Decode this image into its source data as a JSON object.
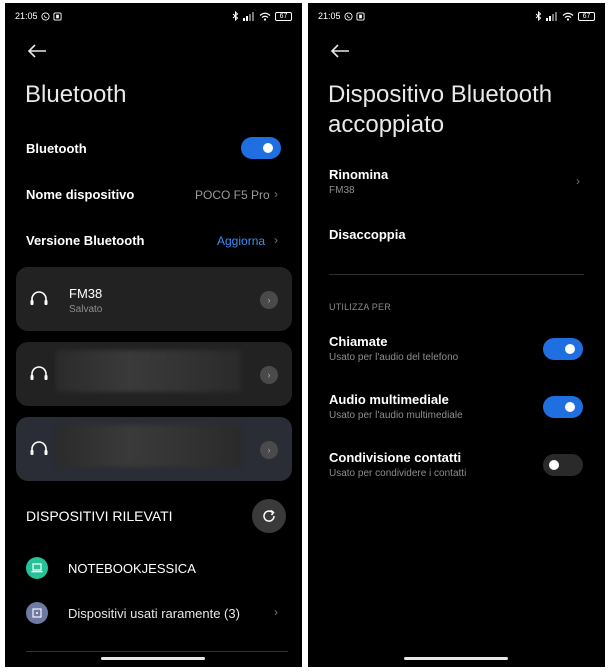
{
  "left": {
    "status": {
      "time": "21:05",
      "battery": "67"
    },
    "title": "Bluetooth",
    "bluetooth_row": {
      "label": "Bluetooth",
      "enabled": true
    },
    "device_name_row": {
      "label": "Nome dispositivo",
      "value": "POCO F5 Pro"
    },
    "version_row": {
      "label": "Versione Bluetooth",
      "value": "Aggiorna"
    },
    "paired": [
      {
        "name": "FM38",
        "status": "Salvato",
        "icon": "headphones-icon"
      },
      {
        "name": "",
        "status": "",
        "icon": "headphones-icon",
        "blurred": true
      },
      {
        "name": "",
        "status": "",
        "icon": "headphones-icon",
        "blurred": true
      }
    ],
    "detected_header": "DISPOSITIVI RILEVATI",
    "detected": [
      {
        "name": "NOTEBOOKJESSICA",
        "icon": "laptop-icon",
        "icon_color": "#28c29a"
      },
      {
        "name": "Dispositivi usati raramente (3)",
        "icon": "device-icon",
        "icon_color": "#6f7aa3"
      }
    ]
  },
  "right": {
    "status": {
      "time": "21:05",
      "battery": "67"
    },
    "title_line1": "Dispositivo Bluetooth",
    "title_line2": "accoppiato",
    "rename": {
      "label": "Rinomina",
      "value": "FM38"
    },
    "unpair": {
      "label": "Disaccoppia"
    },
    "section": "UTILIZZA PER",
    "uses": [
      {
        "label": "Chiamate",
        "desc": "Usato per l'audio del telefono",
        "enabled": true
      },
      {
        "label": "Audio multimediale",
        "desc": "Usato per l'audio multimediale",
        "enabled": true
      },
      {
        "label": "Condivisione contatti",
        "desc": "Usato per condividere i contatti",
        "enabled": false
      }
    ]
  },
  "colors": {
    "accent": "#1f6fe0",
    "link": "#3d8ef5",
    "background": "#000000",
    "card": "#222222"
  }
}
